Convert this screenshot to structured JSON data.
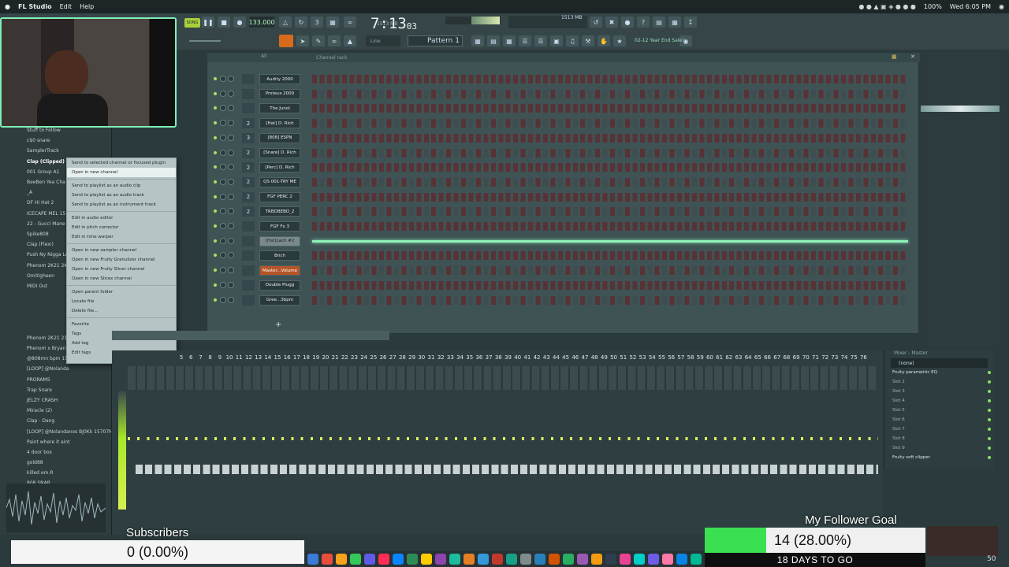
{
  "menubar": {
    "app": "FL Studio",
    "items": [
      "Edit",
      "Help"
    ],
    "status": "100%",
    "clock": "Wed 6:05 PM"
  },
  "toolbar": {
    "song_mode": "SONG",
    "tempo": "133.000",
    "time": "7:13",
    "time_sub": "03",
    "memory": "1513 MB",
    "voices": "2",
    "pattern": "Pattern 1",
    "snap": "Line",
    "news": "02-12 Year End Sale!"
  },
  "browser": {
    "items": [
      "Stuff to Follow",
      "c$0 snare",
      "SamplerTrack",
      "Clap (Clipped)",
      "001 Group A1",
      "BeeBen Yea Cha",
      "_A",
      "DF Hi Hat 2",
      "ICECAPE MEL 15",
      "22 - Gucci Mane II",
      "Spike808",
      "Clap (Flexi)",
      "Push Ny Nigga Lo",
      "Phenom 2K21 2K",
      "Omitigheen",
      "MIDI Out",
      "",
      "",
      "",
      "",
      "Phenom 2K21 21",
      "Phenom x Bryan",
      "@808mn bpm 15",
      "[LOOP] @Nolanda",
      "PRORAMS",
      "Trap Snare",
      "JELZY CRASH",
      "Miracle (2)",
      "Clap - Dang",
      "[LOOP] @Nolandanos BJ0Kk 15707M",
      "Paint where it aint",
      "4 door box",
      "gold88",
      "killed em.R",
      "808 SNAR"
    ]
  },
  "context_menu": {
    "items": [
      {
        "label": "Send to selected channel or focused plugin",
        "hl": false
      },
      {
        "label": "Open in new channel",
        "hl": true
      },
      {
        "sep": true
      },
      {
        "label": "Send to playlist as an audio clip",
        "hl": false
      },
      {
        "label": "Send to playlist as an audio track",
        "hl": false
      },
      {
        "label": "Send to playlist as an instrument track",
        "hl": false
      },
      {
        "sep": true
      },
      {
        "label": "Edit in audio editor",
        "hl": false
      },
      {
        "label": "Edit in pitch corrector",
        "hl": false
      },
      {
        "label": "Edit in time warper",
        "hl": false
      },
      {
        "sep": true
      },
      {
        "label": "Open in new sampler channel",
        "hl": false
      },
      {
        "label": "Open in new Fruity Granulizer channel",
        "hl": false
      },
      {
        "label": "Open in new Fruity Slicer channel",
        "hl": false
      },
      {
        "label": "Open in new Slicex channel",
        "hl": false
      },
      {
        "sep": true
      },
      {
        "label": "Open parent folder",
        "hl": false
      },
      {
        "label": "Locate file",
        "hl": false
      },
      {
        "label": "Delete file...",
        "hl": false
      },
      {
        "sep": true
      },
      {
        "label": "Favorite",
        "hl": false
      },
      {
        "label": "Tags",
        "hl": false,
        "arrow": true
      },
      {
        "label": "Add tag",
        "hl": false
      },
      {
        "label": "Edit tags",
        "hl": false
      }
    ]
  },
  "channel_rack": {
    "title": "Channel rack",
    "filter": "All",
    "channels": [
      {
        "num": "",
        "name": "Audity 2000",
        "style": ""
      },
      {
        "num": "",
        "name": "Proteus 2000",
        "style": ""
      },
      {
        "num": "",
        "name": "The Junol",
        "style": ""
      },
      {
        "num": "2",
        "name": "[Hat] D. Rich",
        "style": ""
      },
      {
        "num": "3",
        "name": "[808] ESPN",
        "style": ""
      },
      {
        "num": "2",
        "name": "[Snare] D. Rich",
        "style": ""
      },
      {
        "num": "2",
        "name": "[Perc] D. Rich",
        "style": ""
      },
      {
        "num": "2",
        "name": "QS 001-TRY ME",
        "style": ""
      },
      {
        "num": "2",
        "name": "FGF PERC 2",
        "style": ""
      },
      {
        "num": "2",
        "name": "TRBDBEBO_2",
        "style": ""
      },
      {
        "num": "",
        "name": "FGF Fx 3",
        "style": ""
      },
      {
        "num": "",
        "name": "[Hat]Lach #2",
        "style": "sel"
      },
      {
        "num": "",
        "name": "Brich",
        "style": ""
      },
      {
        "num": "",
        "name": "Master...Volume",
        "style": "orange"
      },
      {
        "num": "",
        "name": "Double Plugg",
        "style": ""
      },
      {
        "num": "",
        "name": "Gree...3bpm",
        "style": ""
      }
    ]
  },
  "mixer": {
    "numbers": [
      "5",
      "6",
      "7",
      "8",
      "9",
      "10",
      "11",
      "12",
      "13",
      "14",
      "15",
      "16",
      "17",
      "18",
      "19",
      "20",
      "21",
      "22",
      "23",
      "24",
      "25",
      "26",
      "27",
      "28",
      "29",
      "30",
      "31",
      "32",
      "33",
      "34",
      "35",
      "36",
      "37",
      "38",
      "39",
      "40",
      "41",
      "42",
      "43",
      "44",
      "45",
      "46",
      "47",
      "48",
      "49",
      "50",
      "51",
      "52",
      "53",
      "54",
      "55",
      "56",
      "57",
      "58",
      "59",
      "60",
      "61",
      "62",
      "63",
      "64",
      "65",
      "66",
      "67",
      "68",
      "69",
      "70",
      "71",
      "72",
      "73",
      "74",
      "75",
      "76"
    ]
  },
  "insert_panel": {
    "title": "Mixer - Master",
    "preset": "(none)",
    "slots": [
      "Fruity parametric EQ",
      "Slot 2",
      "Slot 3",
      "Slot 4",
      "Slot 5",
      "Slot 6",
      "Slot 7",
      "Slot 8",
      "Slot 9",
      "Fruity soft clipper"
    ]
  },
  "overlay": {
    "subs_title": "Subscribers",
    "subs_value": "0 (0.00%)",
    "goal_title": "My Follower Goal",
    "goal_value": "14 (28.00%)",
    "goal_progress": 0.28,
    "goal_sub": "18 DAYS TO GO",
    "fps": "50"
  }
}
